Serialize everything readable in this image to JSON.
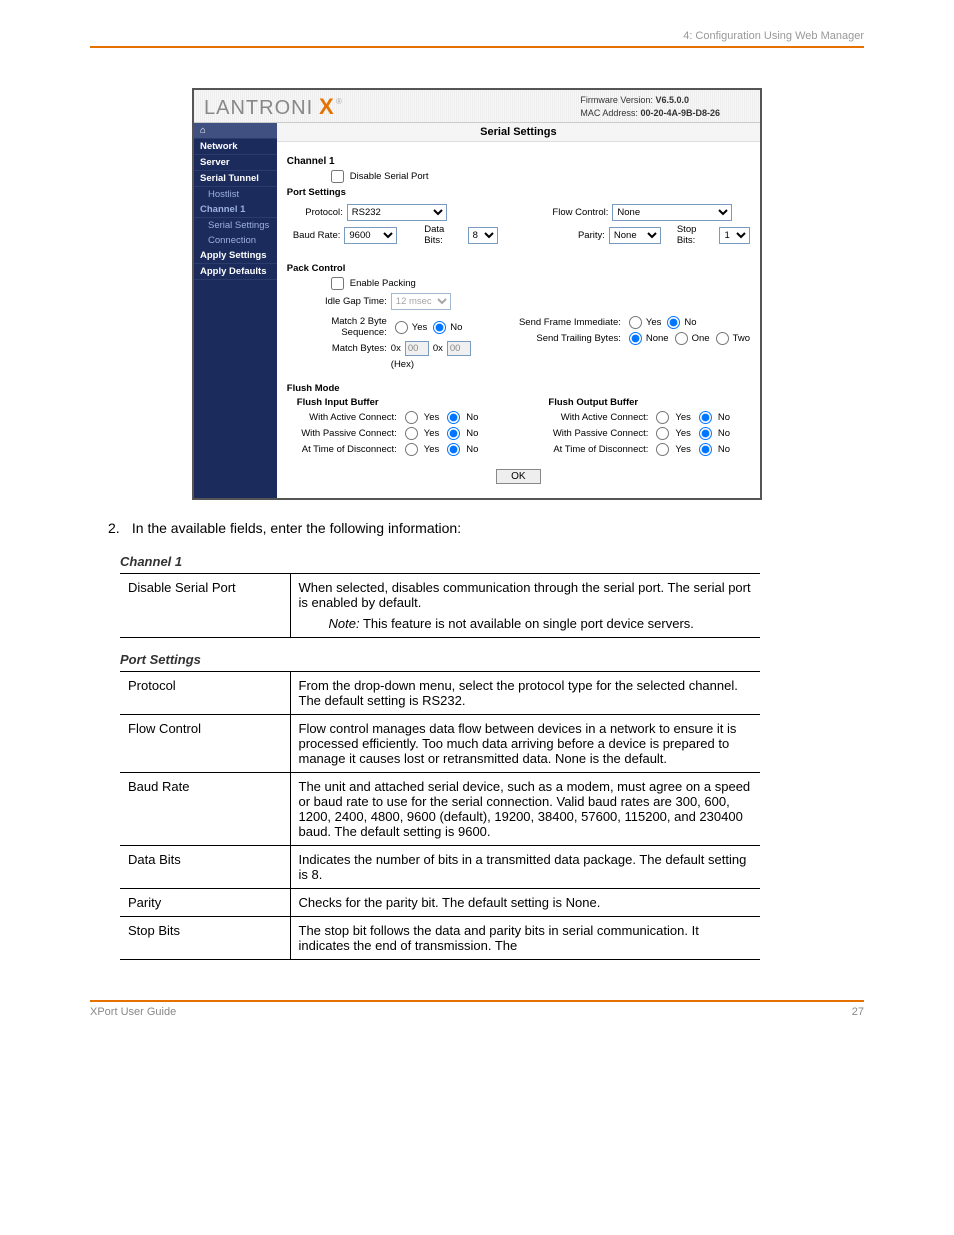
{
  "header_text": "4: Configuration Using Web Manager",
  "firmware": {
    "version_label": "Firmware Version:",
    "version": "V6.5.0.0",
    "mac_label": "MAC Address:",
    "mac": "00-20-4A-9B-D8-26"
  },
  "sidebar": {
    "network": "Network",
    "server": "Server",
    "serial_tunnel": "Serial Tunnel",
    "hostlist": "Hostlist",
    "channel1": "Channel 1",
    "serial_settings": "Serial Settings",
    "connection": "Connection",
    "apply_settings": "Apply Settings",
    "apply_defaults": "Apply Defaults"
  },
  "main": {
    "title": "Serial Settings",
    "channel_heading": "Channel 1",
    "disable_port": "Disable Serial Port",
    "port_settings": "Port Settings",
    "protocol_label": "Protocol:",
    "protocol_value": "RS232",
    "flow_label": "Flow Control:",
    "flow_value": "None",
    "baud_label": "Baud Rate:",
    "baud_value": "9600",
    "databits_label": "Data Bits:",
    "databits_value": "8",
    "parity_label": "Parity:",
    "parity_value": "None",
    "stopbits_label": "Stop Bits:",
    "stopbits_value": "1",
    "pack_control": "Pack Control",
    "enable_packing": "Enable Packing",
    "idle_gap_label": "Idle Gap Time:",
    "idle_gap_value": "12 msec",
    "match2_label": "Match 2 Byte Sequence:",
    "send_frame_label": "Send Frame Immediate:",
    "match_bytes_label": "Match Bytes:",
    "hex_prefix": "0x",
    "match_byte1": "00",
    "match_byte2": "00",
    "hex_hint": "(Hex)",
    "send_trailing_label": "Send Trailing Bytes:",
    "opt_none": "None",
    "opt_one": "One",
    "opt_two": "Two",
    "yes": "Yes",
    "no": "No",
    "flush_mode": "Flush Mode",
    "flush_input": "Flush Input Buffer",
    "flush_output": "Flush Output Buffer",
    "active_connect": "With Active Connect:",
    "passive_connect": "With Passive Connect:",
    "time_disconnect": "At Time of Disconnect:",
    "ok": "OK"
  },
  "instruction": {
    "num": "2.",
    "text": "In the available fields, enter the following information:"
  },
  "caption1": "Channel 1",
  "table1": [
    {
      "left": "Disable Serial Port",
      "right": "When selected, disables communication through the serial port. The serial port is enabled by default.",
      "note": "This feature is not available on single port device servers."
    }
  ],
  "caption2": "Port Settings",
  "table2": [
    {
      "left": "Protocol",
      "right": "From the drop-down menu, select the protocol type for the selected channel. The default setting is RS232."
    },
    {
      "left": "Flow Control",
      "right": "Flow control manages data flow between devices in a network to ensure it is processed efficiently. Too much data arriving before a device is prepared to manage it causes lost or retransmitted data. None is the default."
    },
    {
      "left": "Baud Rate",
      "right": "The unit and attached serial device, such as a modem, must agree on a speed or baud rate to use for the serial connection. Valid baud rates are 300, 600, 1200, 2400, 4800, 9600 (default), 19200, 38400, 57600, 115200, and 230400 baud. The default setting is 9600."
    },
    {
      "left": "Data Bits",
      "right": "Indicates the number of bits in a transmitted data package. The default setting is 8."
    },
    {
      "left": "Parity",
      "right": "Checks for the parity bit. The default setting is None."
    },
    {
      "left": "Stop Bits",
      "right": "The stop bit follows the data and parity bits in serial communication. It indicates the end of transmission. The"
    }
  ],
  "footer": {
    "left": "XPort User Guide",
    "right": "27"
  }
}
